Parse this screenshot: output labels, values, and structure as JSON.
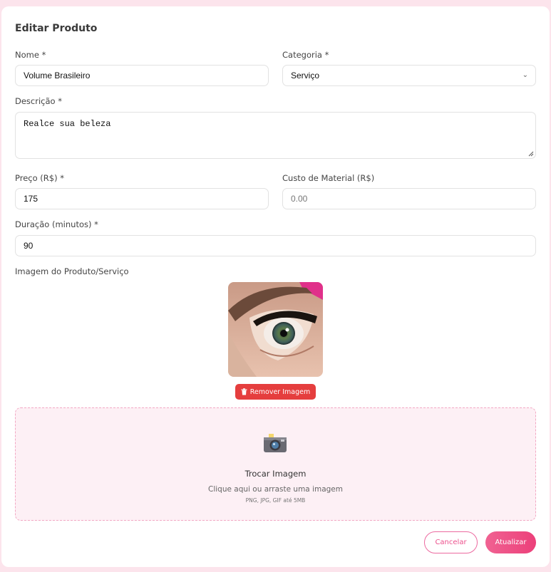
{
  "form": {
    "title": "Editar Produto",
    "nome_label": "Nome *",
    "nome_value": "Volume Brasileiro",
    "categoria_label": "Categoria *",
    "categoria_value": "Serviço",
    "descricao_label": "Descrição *",
    "descricao_value": "Realce sua beleza",
    "preco_label": "Preço (R$) *",
    "preco_value": "175",
    "custo_label": "Custo de Material (R$)",
    "custo_placeholder": "0.00",
    "duracao_label": "Duração (minutos) *",
    "duracao_value": "90",
    "imagem_label": "Imagem do Produto/Serviço"
  },
  "image": {
    "remove_label": "Remover Imagem",
    "remove_icon": "trash-icon"
  },
  "dropzone": {
    "icon": "camera-icon",
    "title": "Trocar Imagem",
    "subtitle": "Clique aqui ou arraste uma imagem",
    "hint": "PNG, JPG, GIF até 5MB"
  },
  "actions": {
    "cancel_label": "Cancelar",
    "update_label": "Atualizar"
  },
  "colors": {
    "background": "#fce4ec",
    "danger": "#e53e3e",
    "accent": "#ec407a"
  }
}
